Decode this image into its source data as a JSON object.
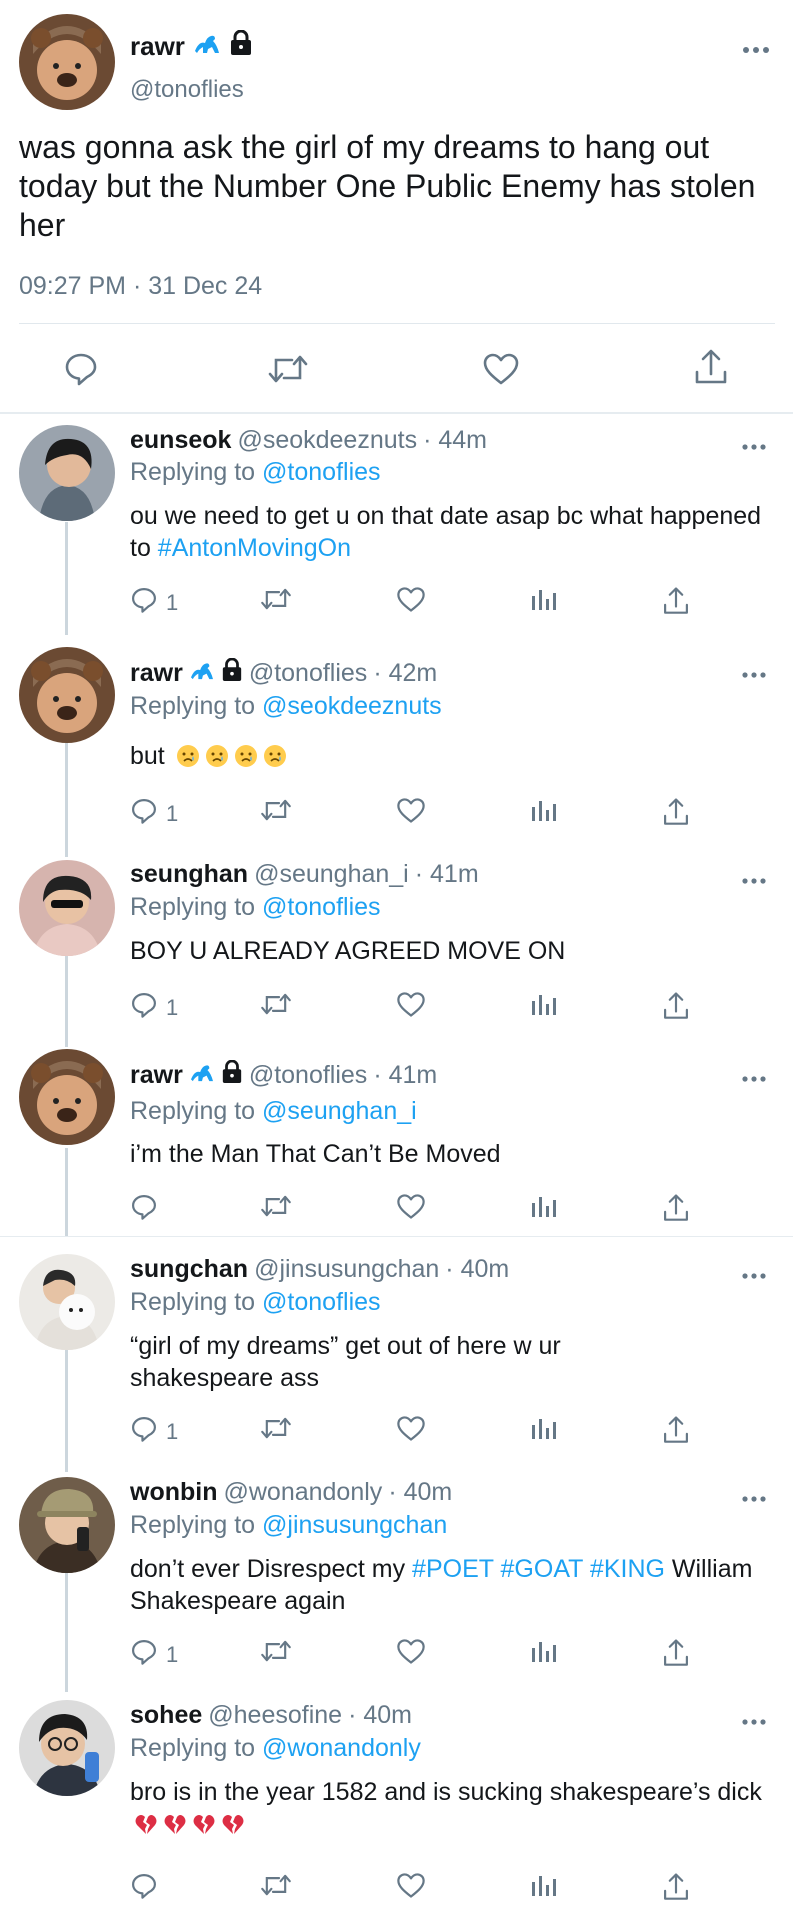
{
  "main_tweet": {
    "display_name": "rawr",
    "badges": [
      "dinosaur-icon",
      "lock-icon"
    ],
    "handle": "@tonoflies",
    "text": "was gonna ask the girl of my dreams to hang out today but the Number One Public Enemy has stolen her",
    "timestamp": "09:27 PM · 31 Dec 24"
  },
  "replies": [
    {
      "name": "eunseok",
      "handle": "@seokdeeznuts",
      "time": "· 44m",
      "replying_prefix": "Replying to ",
      "replying_to": "@tonoflies",
      "text_parts": [
        {
          "t": "ou we need to get u on that date asap bc what happened to "
        },
        {
          "t": "#AntonMovingOn",
          "tag": true
        }
      ],
      "reply_count": "1"
    },
    {
      "name": "rawr",
      "handle": "@tonoflies",
      "time": "· 42m",
      "replying_prefix": "Replying to ",
      "replying_to": "@seokdeeznuts",
      "text": "but",
      "emojis": [
        "crying-face-emoji",
        "crying-face-emoji",
        "crying-face-emoji",
        "crying-face-emoji"
      ],
      "reply_count": "1"
    },
    {
      "name": "seunghan",
      "handle": "@seunghan_i",
      "time": "· 41m",
      "replying_prefix": "Replying to ",
      "replying_to": "@tonoflies",
      "text": "BOY U ALREADY AGREED MOVE ON",
      "reply_count": "1"
    },
    {
      "name": "rawr",
      "handle": "@tonoflies",
      "time": "· 41m",
      "replying_prefix": "Replying to ",
      "replying_to": "@seunghan_i",
      "text": "i’m the Man That Can’t Be Moved",
      "reply_count": ""
    },
    {
      "name": "sungchan",
      "handle": "@jinsusungchan",
      "time": "· 40m",
      "replying_prefix": "Replying to ",
      "replying_to": "@tonoflies",
      "text": "“girl of my dreams” get out of here w ur shakespeare ass",
      "reply_count": "1"
    },
    {
      "name": "wonbin",
      "handle": "@wonandonly",
      "time": "· 40m",
      "replying_prefix": "Replying to ",
      "replying_to": "@jinsusungchan",
      "text_parts": [
        {
          "t": "don’t ever Disrespect my "
        },
        {
          "t": "#POET",
          "tag": true
        },
        {
          "t": " "
        },
        {
          "t": "#GOAT",
          "tag": true
        },
        {
          "t": " "
        },
        {
          "t": "#KING",
          "tag": true
        },
        {
          "t": " William Shakespeare again"
        }
      ],
      "reply_count": "1"
    },
    {
      "name": "sohee",
      "handle": "@heesofine",
      "time": "· 40m",
      "replying_prefix": "Replying to ",
      "replying_to": "@wonandonly",
      "text": "bro is in the year 1582 and is sucking shakespeare’s dick",
      "emojis": [
        "broken-heart-emoji",
        "broken-heart-emoji",
        "broken-heart-emoji",
        "broken-heart-emoji"
      ],
      "reply_count": ""
    }
  ],
  "colors": {
    "link": "#1da1f2",
    "muted": "#657786",
    "text": "#14171a",
    "divider": "#e1e8ed"
  }
}
